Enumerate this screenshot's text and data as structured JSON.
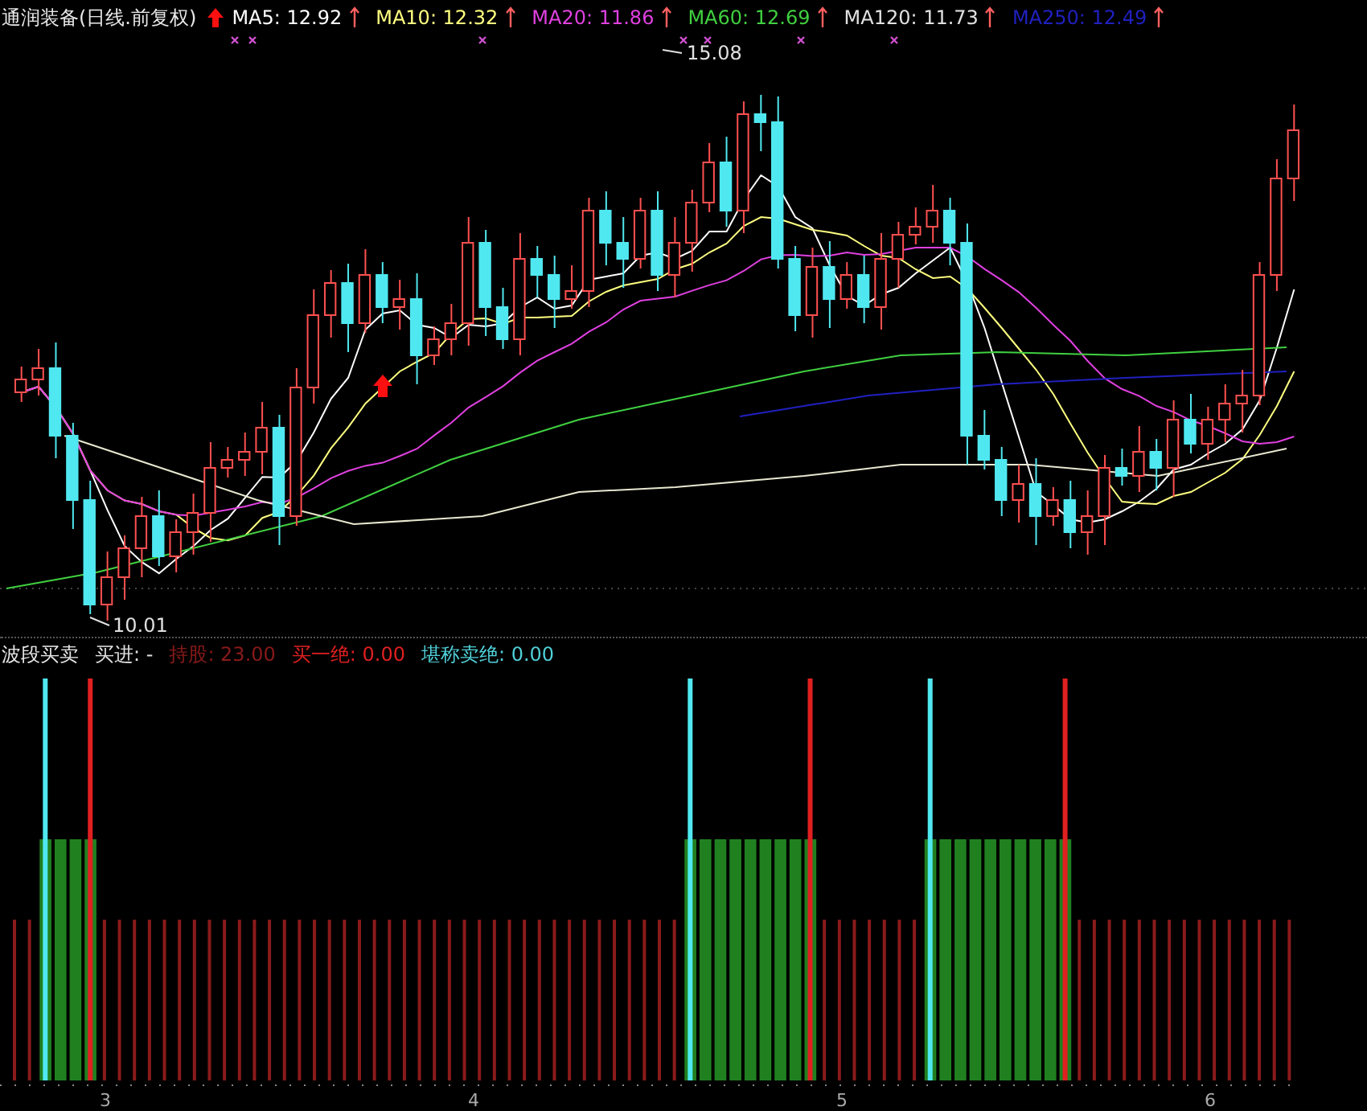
{
  "main_chart": {
    "title": "通润装备(日线.前复权)",
    "legend": [
      {
        "label": "MA5: 12.92",
        "color": "#ffffff"
      },
      {
        "label": "MA10: 12.32",
        "color": "#ffff80"
      },
      {
        "label": "MA20: 11.86",
        "color": "#e040e0"
      },
      {
        "label": "MA60: 12.69",
        "color": "#40d040"
      },
      {
        "label": "MA120: 11.73",
        "color": "#e0e0e0"
      },
      {
        "label": "MA250: 12.49",
        "color": "#2020c0"
      }
    ],
    "high_label": "15.08",
    "low_label": "10.01"
  },
  "indicator": {
    "title": "波段买卖",
    "items": [
      {
        "label": "买进: -",
        "color": "#e0e0e0"
      },
      {
        "label": "持股: 23.00",
        "color": "#8a1a1a"
      },
      {
        "label": "买一绝: 0.00",
        "color": "#e02020"
      },
      {
        "label": "堪称卖绝: 0.00",
        "color": "#50d0d8"
      }
    ]
  },
  "x_axis": {
    "labels": [
      "3",
      "4",
      "5",
      "6"
    ]
  }
}
